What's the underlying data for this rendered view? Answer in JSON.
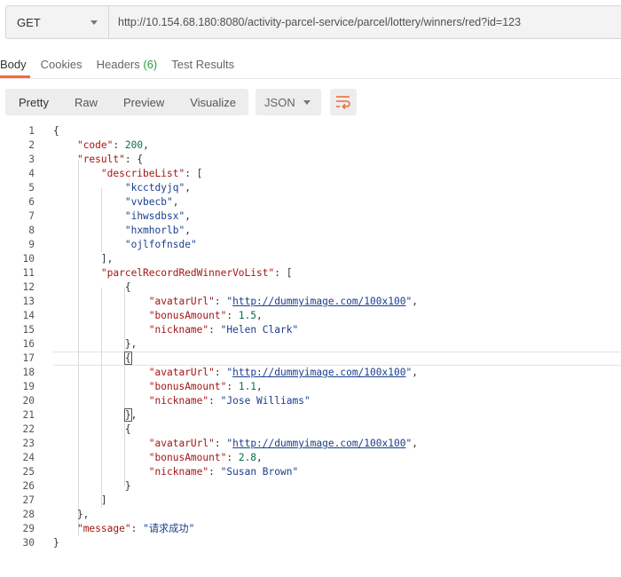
{
  "request": {
    "method": "GET",
    "url": "http://10.154.68.180:8080/activity-parcel-service/parcel/lottery/winners/red?id=123"
  },
  "tabs": [
    {
      "label": "Body",
      "active": true
    },
    {
      "label": "Cookies"
    },
    {
      "label": "Headers",
      "count": "(6)"
    },
    {
      "label": "Test Results"
    }
  ],
  "viewer": {
    "modes": [
      "Pretty",
      "Raw",
      "Preview",
      "Visualize"
    ],
    "active_mode": "Pretty",
    "format": "JSON",
    "wrap_icon": "wrap-lines-icon",
    "accent_color": "#f26b3a"
  },
  "response": {
    "code": 200,
    "describeList": [
      "kcctdyjq",
      "vvbecb",
      "ihwsdbsx",
      "hxmhorlb",
      "ojlfofnsde"
    ],
    "winners": [
      {
        "avatarUrl": "http://dummyimage.com/100x100",
        "bonusAmount": "1.5",
        "nickname": "Helen Clark"
      },
      {
        "avatarUrl": "http://dummyimage.com/100x100",
        "bonusAmount": "1.1",
        "nickname": "Jose Williams"
      },
      {
        "avatarUrl": "http://dummyimage.com/100x100",
        "bonusAmount": "2.8",
        "nickname": "Susan Brown"
      }
    ],
    "message": "请求成功"
  },
  "line_numbers": [
    "1",
    "2",
    "3",
    "4",
    "5",
    "6",
    "7",
    "8",
    "9",
    "10",
    "11",
    "12",
    "13",
    "14",
    "15",
    "16",
    "17",
    "18",
    "19",
    "20",
    "21",
    "22",
    "23",
    "24",
    "25",
    "26",
    "27",
    "28",
    "29",
    "30"
  ]
}
